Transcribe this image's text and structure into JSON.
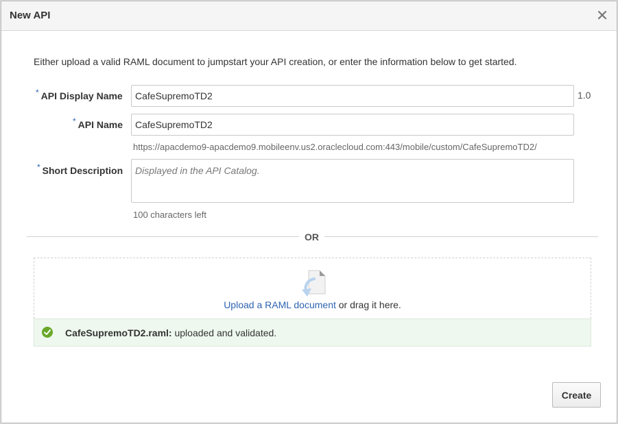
{
  "dialog": {
    "title": "New API",
    "close_icon": "close-icon"
  },
  "intro": "Either upload a valid RAML document to jumpstart your API creation, or enter the information below to get started.",
  "form": {
    "display_name": {
      "required": "*",
      "label": "API Display Name",
      "value": "CafeSupremoTD2",
      "version": "1.0"
    },
    "api_name": {
      "required": "*",
      "label": "API Name",
      "value": "CafeSupremoTD2",
      "url": "https://apacdemo9-apacdemo9.mobileenv.us2.oraclecloud.com:443/mobile/custom/CafeSupremoTD2/"
    },
    "short_description": {
      "required": "*",
      "label": "Short Description",
      "placeholder": "Displayed in the API Catalog.",
      "chars_left": "100 characters left"
    }
  },
  "separator": "OR",
  "upload": {
    "icon": "document-upload-icon",
    "link_text": "Upload a RAML document",
    "suffix_text": " or drag it here."
  },
  "status": {
    "icon": "check-circle-icon",
    "color": "#6aa82a",
    "filename": "CafeSupremoTD2.raml:",
    "message": " uploaded and validated."
  },
  "actions": {
    "create_label": "Create"
  },
  "colors": {
    "link": "#2e63b1",
    "required": "#2e63b1",
    "success_bg": "#eef8ee"
  }
}
